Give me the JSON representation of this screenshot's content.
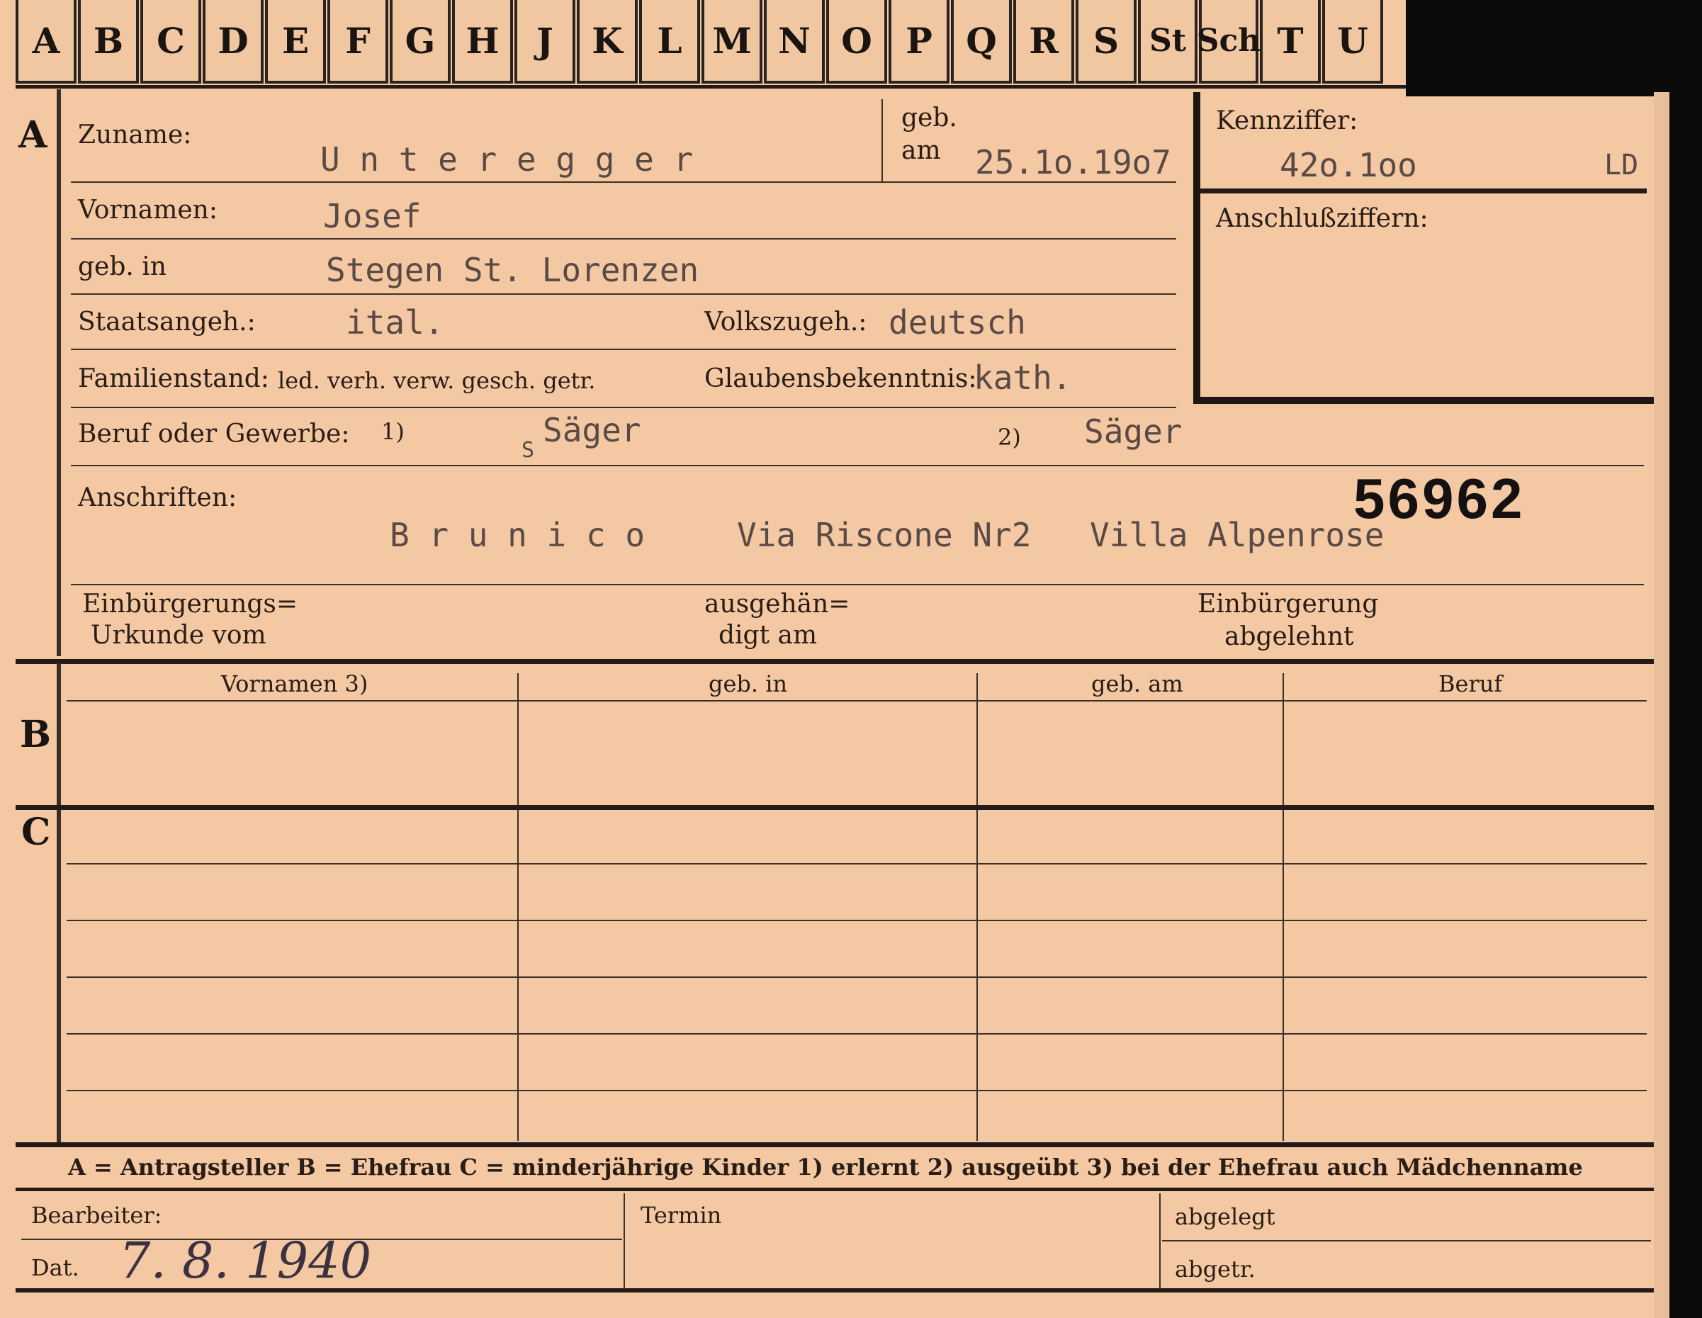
{
  "tabs": [
    "A",
    "B",
    "C",
    "D",
    "E",
    "F",
    "G",
    "H",
    "J",
    "K",
    "L",
    "M",
    "N",
    "O",
    "P",
    "Q",
    "R",
    "S",
    "St",
    "Sch",
    "T",
    "U"
  ],
  "section_a": {
    "marker": "A",
    "zuname_label": "Zuname:",
    "zuname_value": "U n t e r e g g e r",
    "geb_am_label_1": "geb.",
    "geb_am_label_2": "am",
    "geb_am_value": "25.1o.19o7",
    "kennziffer_label": "Kennziffer:",
    "kennziffer_value": "42o.1oo",
    "kennziffer_suffix": "LD",
    "anschluss_label": "Anschlußziffern:",
    "vornamen_label": "Vornamen:",
    "vornamen_value": "Josef",
    "geb_in_label": "geb. in",
    "geb_in_value": "Stegen St. Lorenzen",
    "staatsangeh_label": "Staatsangeh.:",
    "staatsangeh_value": "ital.",
    "volkszugeh_label": "Volkszugeh.:",
    "volkszugeh_value": "deutsch",
    "familienstand_label": "Familienstand:",
    "familienstand_options": "led. verh. verw. gesch. getr.",
    "glaubens_label": "Glaubensbekenntnis:",
    "glaubens_value": "kath.",
    "beruf_label": "Beruf oder Gewerbe:",
    "beruf_note1": "1)",
    "beruf_value1": "Säger",
    "beruf_mark": "S",
    "beruf_note2": "2)",
    "beruf_value2": "Säger",
    "anschriften_label": "Anschriften:",
    "anschriften_number": "56962",
    "anschriften_value_city": "B r u n i c o",
    "anschriften_value_street": "Via Riscone Nr2",
    "anschriften_value_villa": "Villa Alpenrose",
    "einbuerg_label_1": "Einbürgerungs=",
    "einbuerg_label_2": "Urkunde vom",
    "ausgehaen_label_1": "ausgehän=",
    "ausgehaen_label_2": "digt am",
    "abgelehnt_label_1": "Einbürgerung",
    "abgelehnt_label_2": "abgelehnt"
  },
  "section_b": {
    "marker": "B",
    "columns": [
      "Vornamen 3)",
      "geb. in",
      "geb. am",
      "Beruf"
    ]
  },
  "section_c": {
    "marker": "C"
  },
  "legend": "A = Antragsteller   B = Ehefrau   C = minderjährige Kinder   1) erlernt   2) ausgeübt   3) bei der Ehefrau auch Mädchenname",
  "footer": {
    "bearbeiter_label": "Bearbeiter:",
    "dat_label": "Dat.",
    "dat_value": "7. 8. 1940",
    "termin_label": "Termin",
    "abgelegt_label": "abgelegt",
    "abgetr_label": "abgetr."
  }
}
